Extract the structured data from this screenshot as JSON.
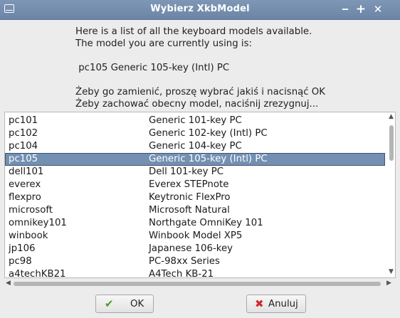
{
  "window": {
    "title": "Wybierz XkbModel",
    "minimize": "‒",
    "maximize": "+",
    "close": "✕"
  },
  "info": {
    "line1": "Here is a list of all the keyboard models available.",
    "line2": "The model you are currently using is:",
    "current": " pc105 Generic 105-key (Intl) PC",
    "line4": "Żeby go zamienić, proszę wybrać jakiś i nacisnąć OK",
    "line5": "Żeby zachować obecny model, naciśnij zrezygnuj..."
  },
  "models": [
    {
      "id": "pc101",
      "name": "Generic 101-key PC"
    },
    {
      "id": "pc102",
      "name": "Generic 102-key (Intl) PC"
    },
    {
      "id": "pc104",
      "name": "Generic 104-key PC"
    },
    {
      "id": "pc105",
      "name": "Generic 105-key (Intl) PC"
    },
    {
      "id": "dell101",
      "name": "Dell 101-key PC"
    },
    {
      "id": "everex",
      "name": "Everex STEPnote"
    },
    {
      "id": "flexpro",
      "name": "Keytronic FlexPro"
    },
    {
      "id": "microsoft",
      "name": "Microsoft Natural"
    },
    {
      "id": "omnikey101",
      "name": "Northgate OmniKey 101"
    },
    {
      "id": "winbook",
      "name": "Winbook Model XP5"
    },
    {
      "id": "jp106",
      "name": "Japanese 106-key"
    },
    {
      "id": "pc98",
      "name": "PC-98xx Series"
    },
    {
      "id": "a4techKB21",
      "name": "A4Tech KB-21"
    }
  ],
  "selected_index": 3,
  "buttons": {
    "ok": "OK",
    "cancel": "Anuluj"
  },
  "icons": {
    "ok": "check-icon",
    "cancel": "x-icon"
  },
  "colors": {
    "titlebar": "#7389a9",
    "selection": "#7390b2",
    "ok_icon": "#4f9a2c",
    "cancel_icon": "#d42b2b"
  }
}
